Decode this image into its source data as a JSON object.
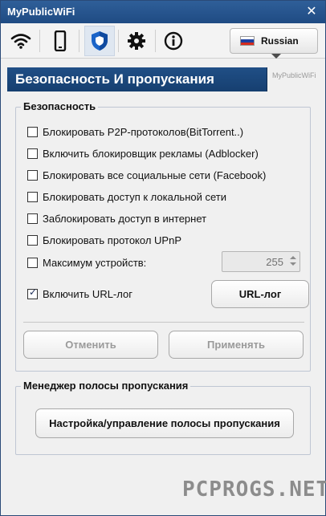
{
  "window": {
    "title": "MyPublicWiFi"
  },
  "toolbar": {
    "buttons": [
      {
        "icon": "wifi-icon"
      },
      {
        "icon": "phone-icon"
      },
      {
        "icon": "shield-icon"
      },
      {
        "icon": "gear-icon"
      },
      {
        "icon": "info-icon"
      }
    ],
    "active": "shield-icon",
    "language": {
      "label": "Russian",
      "flag_colors": [
        "#ffffff",
        "#1c3fa0",
        "#d52b1e"
      ]
    }
  },
  "header": {
    "title": "Безопасность И пропускания",
    "brand": "MyPublicWiFi"
  },
  "security": {
    "legend": "Безопасность",
    "options": [
      {
        "label": "Блокировать P2P-протоколов(BitTorrent..)",
        "checked": false
      },
      {
        "label": "Включить блокировщик рекламы (Adblocker)",
        "checked": false
      },
      {
        "label": "Блокировать все социальные сети (Facebook)",
        "checked": false
      },
      {
        "label": "Блокировать доступ к локальной сети",
        "checked": false
      },
      {
        "label": "Заблокировать доступ в интернет",
        "checked": false
      },
      {
        "label": "Блокировать протокол UPnP",
        "checked": false
      }
    ],
    "max_devices": {
      "label": "Максимум устройств:",
      "checked": false,
      "value": "255"
    },
    "url_log": {
      "label": "Включить URL-лог",
      "checked": true,
      "button": "URL-лог"
    },
    "cancel_label": "Отменить",
    "apply_label": "Применять"
  },
  "bandwidth": {
    "legend": "Менеджер полосы пропускания",
    "button": "Настройка/управление полосы пропускания"
  },
  "watermark": "PCPROGS.NET",
  "colors": {
    "title_bar": "#2f5f99",
    "header": "#1f4e85"
  }
}
